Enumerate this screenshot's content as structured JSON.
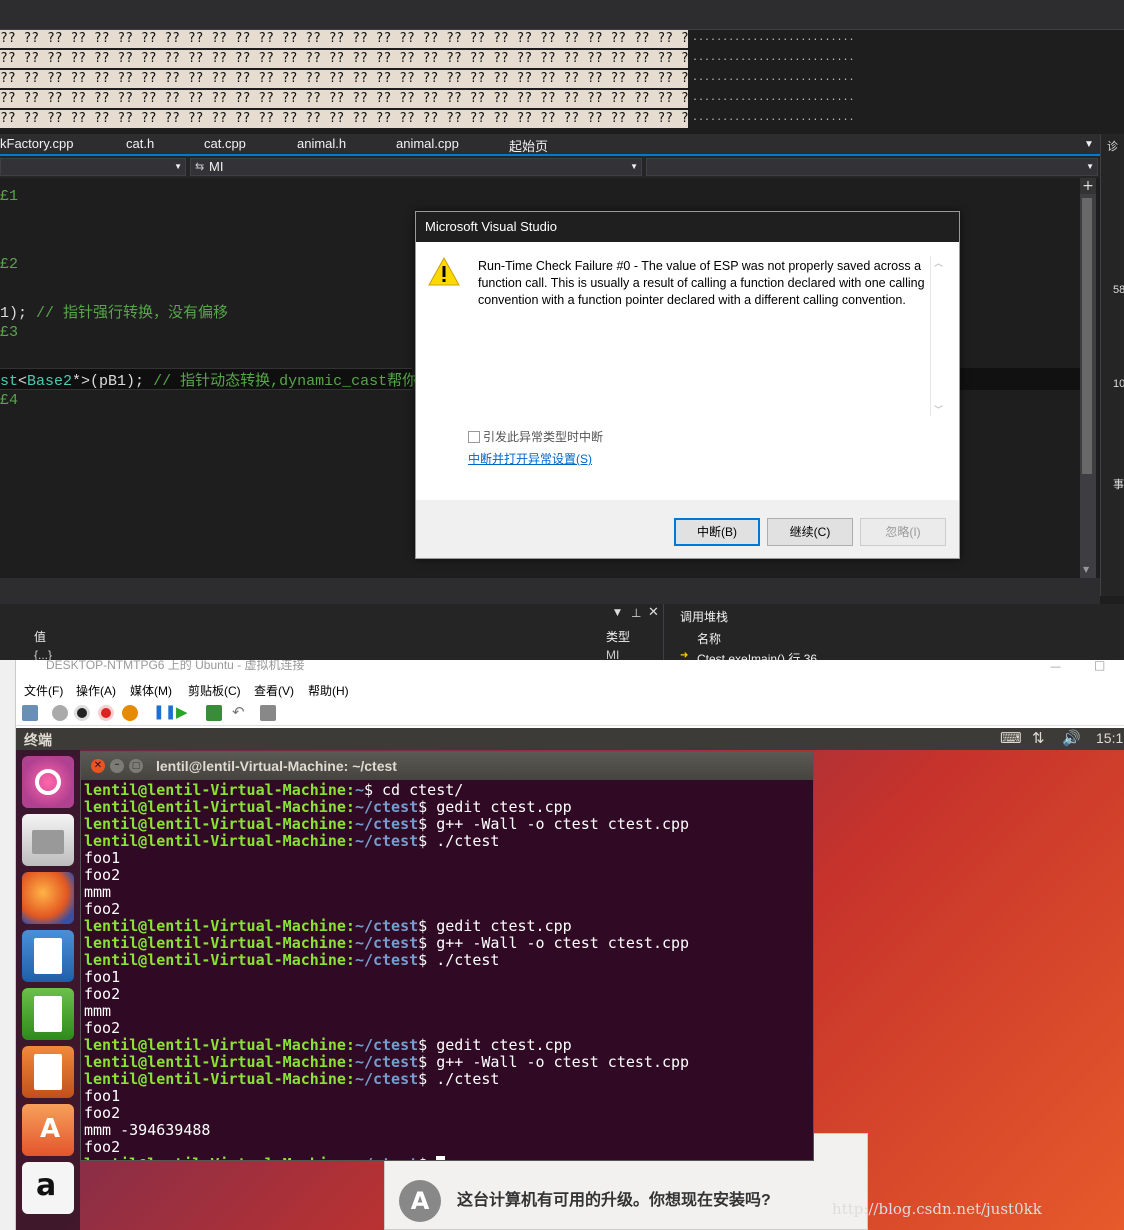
{
  "vs": {
    "memory_rows": [
      "?? ?? ?? ?? ?? ?? ?? ?? ?? ?? ?? ?? ?? ?? ?? ?? ?? ?? ?? ?? ?? ?? ?? ?? ?? ?? ?? ?? ?? ?? ?? ?? ?? ?? ?? ?? ?? ?? ?? ?? ?? ?? ?? ?? ?? ?? ?? ?? ?? ?? ?? ?? ?? ?? ?? ?? ??",
      "?? ?? ?? ?? ?? ?? ?? ?? ?? ?? ?? ?? ?? ?? ?? ?? ?? ?? ?? ?? ?? ?? ?? ?? ?? ?? ?? ?? ?? ?? ?? ?? ?? ?? ?? ?? ?? ?? ?? ?? ?? ?? ?? ?? ?? ?? ?? ?? ?? ?? ?? ?? ?? ?? ?? ?? ??",
      "?? ?? ?? ?? ?? ?? ?? ?? ?? ?? ?? ?? ?? ?? ?? ?? ?? ?? ?? ?? ?? ?? ?? ?? ?? ?? ?? ?? ?? ?? ?? ?? ?? ?? ?? ?? ?? ?? ?? ?? ?? ?? ?? ?? ?? ?? ?? ?? ?? ?? ?? ?? ?? ?? ?? ?? ??",
      "?? ?? ?? ?? ?? ?? ?? ?? ?? ?? ?? ?? ?? ?? ?? ?? ?? ?? ?? ?? ?? ?? ?? ?? ?? ?? ?? ?? ?? ?? ?? ?? ?? ?? ?? ?? ?? ?? ?? ?? ?? ?? ?? ?? ?? ?? ?? ?? ?? ?? ?? ?? ?? ?? ?? ?? ??",
      "?? ?? ?? ?? ?? ?? ?? ?? ?? ?? ?? ?? ?? ?? ?? ?? ?? ?? ?? ?? ?? ?? ?? ?? ?? ?? ?? ?? ?? ?? ?? ?? ?? ?? ?? ?? ?? ?? ?? ?? ?? ?? ?? ?? ?? ?? ?? ?? ?? ?? ?? ?? ?? ?? ?? ?? ??"
    ],
    "memory_dots": "................................................................",
    "tabs": [
      "kFactory.cpp",
      "cat.h",
      "cat.cpp",
      "animal.h",
      "animal.cpp",
      "起始页"
    ],
    "nav_member": "MI",
    "code": {
      "l1": "£1",
      "l2": "£2",
      "l3_a": "1); ",
      "l3_b": "// 指针强行转换，没有偏移",
      "l4": "£3",
      "l5_a": "st",
      "l5_b": "<",
      "l5_c": "Base2",
      "l5_d": "*>(pB1); ",
      "l5_e": "// 指针动态转换,dynamic_cast帮你偏移",
      "l6": "£4"
    },
    "watch": {
      "col_value": "值",
      "col_type": "类型",
      "row_value": "{...}",
      "row_type": "MI"
    },
    "callstack": {
      "title": "调用堆栈",
      "col_name": "名称",
      "row": "Ctest.exe!main() 行 36"
    },
    "right_pane": {
      "label1": "诊",
      "label2": "58",
      "label3": "10",
      "label4": "事"
    }
  },
  "dialog": {
    "title": "Microsoft Visual Studio",
    "message": "Run-Time Check Failure #0 - The value of ESP was not properly saved across a function call.  This is usually a result of calling a function declared with one calling convention with a function pointer declared with a different calling convention.",
    "checkbox": "引发此异常类型时中断",
    "link": "中断并打开异常设置(S)",
    "btn_break": "中断(B)",
    "btn_continue": "继续(C)",
    "btn_ignore": "忽略(I)"
  },
  "hyperv": {
    "title": "DESKTOP-NTMTPG6 上的 Ubuntu - 虚拟机连接",
    "menu": [
      "文件(F)",
      "操作(A)",
      "媒体(M)",
      "剪贴板(C)",
      "查看(V)",
      "帮助(H)"
    ]
  },
  "ubuntu": {
    "panel_title": "终端",
    "clock": "15:1",
    "terminal_title": "lentil@lentil-Virtual-Machine: ~/ctest",
    "update_text": "这台计算机有可用的升级。你想现在安装吗?"
  },
  "terminal_lines": [
    {
      "p": "lentil@lentil-Virtual-Machine",
      "d": "~",
      "c": "$ cd ctest/"
    },
    {
      "p": "lentil@lentil-Virtual-Machine",
      "d": "~/ctest",
      "c": "$ gedit ctest.cpp"
    },
    {
      "p": "lentil@lentil-Virtual-Machine",
      "d": "~/ctest",
      "c": "$ g++ -Wall -o ctest ctest.cpp"
    },
    {
      "p": "lentil@lentil-Virtual-Machine",
      "d": "~/ctest",
      "c": "$ ./ctest"
    },
    {
      "t": "foo1"
    },
    {
      "t": "foo2"
    },
    {
      "t": "mmm"
    },
    {
      "t": "foo2"
    },
    {
      "p": "lentil@lentil-Virtual-Machine",
      "d": "~/ctest",
      "c": "$ gedit ctest.cpp"
    },
    {
      "p": "lentil@lentil-Virtual-Machine",
      "d": "~/ctest",
      "c": "$ g++ -Wall -o ctest ctest.cpp"
    },
    {
      "p": "lentil@lentil-Virtual-Machine",
      "d": "~/ctest",
      "c": "$ ./ctest"
    },
    {
      "t": "foo1"
    },
    {
      "t": "foo2"
    },
    {
      "t": "mmm"
    },
    {
      "t": "foo2"
    },
    {
      "p": "lentil@lentil-Virtual-Machine",
      "d": "~/ctest",
      "c": "$ gedit ctest.cpp"
    },
    {
      "p": "lentil@lentil-Virtual-Machine",
      "d": "~/ctest",
      "c": "$ g++ -Wall -o ctest ctest.cpp"
    },
    {
      "p": "lentil@lentil-Virtual-Machine",
      "d": "~/ctest",
      "c": "$ ./ctest"
    },
    {
      "t": "foo1"
    },
    {
      "t": "foo2"
    },
    {
      "t": "mmm -394639488"
    },
    {
      "t": "foo2"
    },
    {
      "p": "lentil@lentil-Virtual-Machine",
      "d": "~/ctest",
      "c": "$ ",
      "cursor": true
    }
  ],
  "watermark": "http://blog.csdn.net/just0kk"
}
